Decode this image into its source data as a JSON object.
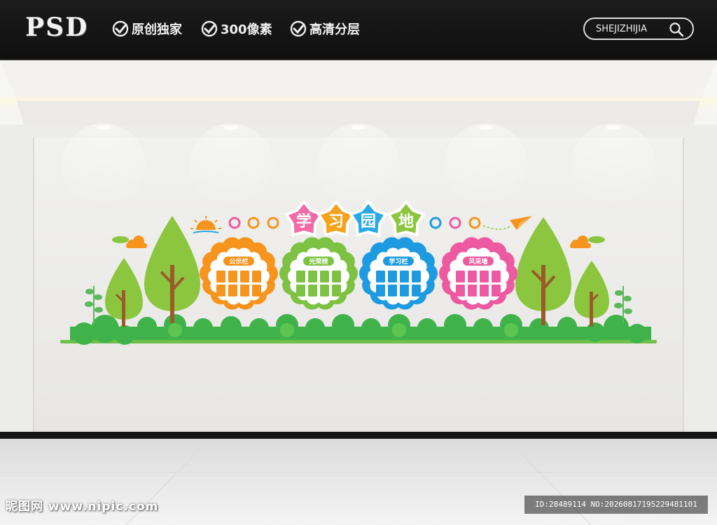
{
  "header": {
    "logo": "PSD",
    "features": [
      {
        "label": "原创独家",
        "icon": "check-circle-icon"
      },
      {
        "label": "300像素",
        "icon": "check-circle-icon"
      },
      {
        "label": "高清分层",
        "icon": "check-circle-icon"
      }
    ],
    "search_text": "SHEJIZHIJIA",
    "search_icon": "magnifier-icon"
  },
  "board": {
    "title_chars": [
      "学",
      "习",
      "园",
      "地"
    ],
    "title_colors": [
      "#f26aa6",
      "#f7a21b",
      "#29a8e6",
      "#8cc63f"
    ],
    "panels": [
      {
        "label": "公示栏",
        "color": "#f7941d"
      },
      {
        "label": "光荣榜",
        "color": "#7dc242"
      },
      {
        "label": "学习栏",
        "color": "#1e9be0"
      },
      {
        "label": "风采墙",
        "color": "#ee5aa1"
      }
    ],
    "ring_colors": [
      "#ee5aa1",
      "#f7941d",
      "#f7941d",
      "#1e9be0",
      "#ee5aa1",
      "#f7941d"
    ]
  },
  "watermark": {
    "left": "昵图网 www.nipic.com",
    "right": "ID:28489114 NO:20260817195229481101"
  }
}
